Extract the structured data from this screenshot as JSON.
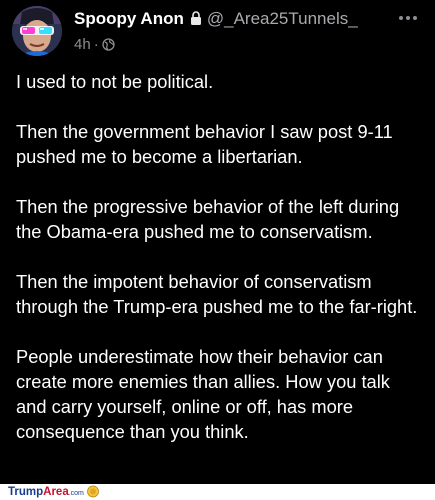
{
  "post": {
    "display_name": "Spoopy Anon",
    "handle": "@_Area25Tunnels_",
    "time": "4h",
    "separator": "·",
    "icons": {
      "lock": "lock-icon",
      "visibility": "globe-icon",
      "more": "more-icon"
    },
    "paragraphs": [
      "I used to not be political.",
      "Then the government behavior I saw post 9-11 pushed me to become a libertarian.",
      "Then the progressive behavior of the left during the Obama-era pushed me to conservatism.",
      "Then the impotent behavior of conservatism through the Trump-era pushed me to the far-right.",
      "People underestimate how their behavior can create more enemies than allies. How you talk and carry yourself, online or off, has more consequence than you think."
    ]
  },
  "watermark": {
    "part1": "Trump",
    "part2": "Area",
    "part3": ".com"
  },
  "colors": {
    "background": "#000000",
    "text": "#ffffff",
    "secondary": "#8b8e92",
    "watermark_blue": "#1a3a8c",
    "watermark_red": "#c8102e"
  }
}
